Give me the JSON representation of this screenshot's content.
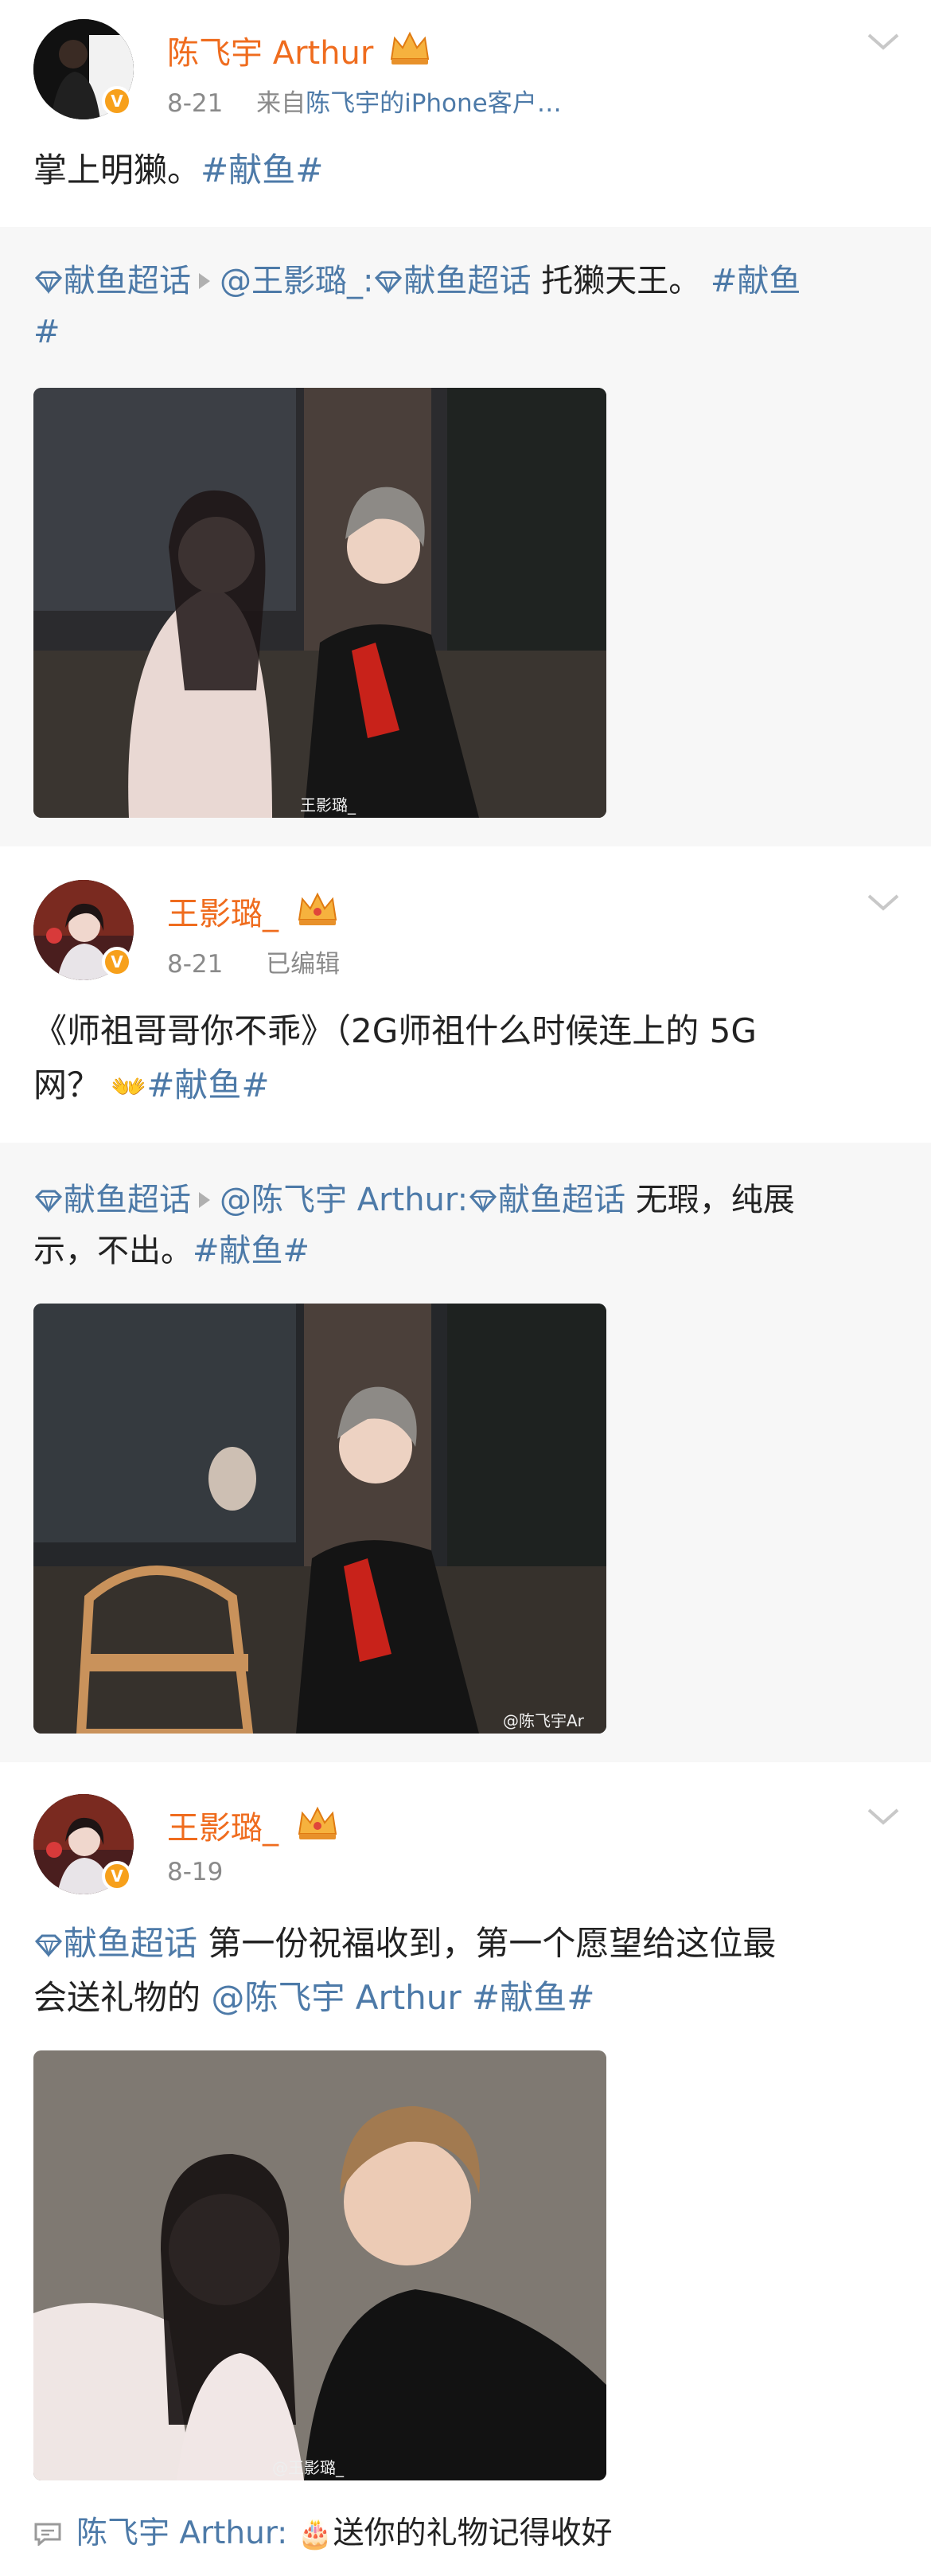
{
  "posts": [
    {
      "author": "陈飞宇 Arthur",
      "date": "8-21",
      "source_prefix": "来自",
      "source": "陈飞宇的iPhone客户…",
      "text_plain": "掌上明獭。",
      "text_tag": "#献鱼#",
      "repost": {
        "supertopic": "献鱼超话",
        "mention": "@王影璐_:",
        "supertopic2": "献鱼超话",
        "text": " 托獭天王。",
        "tag": "#献鱼",
        "tag_cont": "#"
      },
      "photo_watermark": "王影璐_"
    },
    {
      "author": "王影璐_",
      "date": "8-21",
      "edited": "已编辑",
      "text_line1": "《师祖哥哥你不乖》（2G师祖什么时候连上的 5G",
      "text_line2_plain": "网？",
      "text_emoji": "👐",
      "text_tag": "#献鱼#",
      "repost": {
        "supertopic": "献鱼超话",
        "mention": "@陈飞宇 Arthur:",
        "supertopic2": "献鱼超话",
        "text_line1": " 无瑕，纯展",
        "text_line2": "示，不出。",
        "tag": "#献鱼#"
      },
      "photo_watermark": "@陈飞宇Ar"
    },
    {
      "author": "王影璐_",
      "date": "8-19",
      "supertopic": "献鱼超话",
      "text_line1": " 第一份祝福收到，第一个愿望给这位最",
      "text_line2_plain": "会送礼物的 ",
      "mention": "@陈飞宇 Arthur",
      "text_tag": " #献鱼#",
      "photo_watermark": "@王影璐_"
    }
  ],
  "comment": {
    "author": "陈飞宇 Arthur:",
    "emoji": "🎂",
    "text": "送你的礼物记得收好"
  },
  "colors": {
    "accent_name": "#ef6c1e",
    "link_blue": "#4d7aa8",
    "verified_badge": "#f7a01b",
    "repost_bg": "#f7f7f7",
    "divider_bg": "#f2f2f2"
  },
  "icons": [
    "chevron-down-icon",
    "verified-badge-icon",
    "crown-icon",
    "supertopic-gem-icon",
    "comment-icon"
  ]
}
